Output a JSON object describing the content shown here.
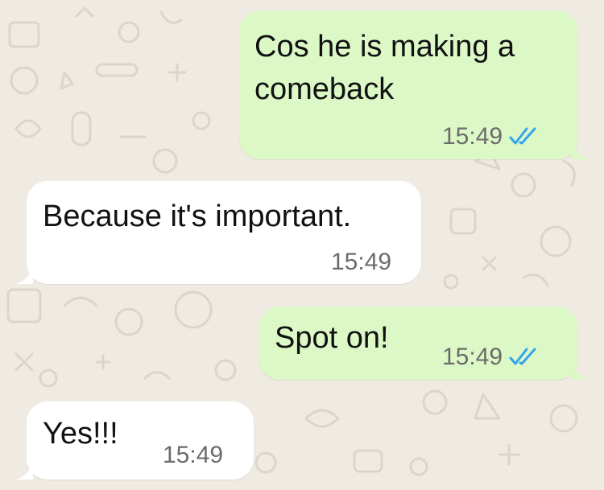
{
  "conversation": {
    "messages": [
      {
        "direction": "outgoing",
        "text_lines": [
          "Cos he is making a",
          "comeback"
        ],
        "time": "15:49",
        "status": "read"
      },
      {
        "direction": "incoming",
        "text_lines": [
          "Because it's important."
        ],
        "time": "15:49"
      },
      {
        "direction": "outgoing",
        "text_lines": [
          "Spot on!"
        ],
        "time": "15:49",
        "status": "read"
      },
      {
        "direction": "incoming",
        "text_lines": [
          "Yes!!!"
        ],
        "time": "15:49"
      }
    ]
  },
  "icons": {
    "read_receipt": "double-check-icon"
  },
  "colors": {
    "background": "#efeae2",
    "outgoing_bubble": "#dcf8c6",
    "incoming_bubble": "#ffffff",
    "read_tick": "#34a4f0",
    "timestamp": "#6b6b6b",
    "message_text": "#111111"
  }
}
